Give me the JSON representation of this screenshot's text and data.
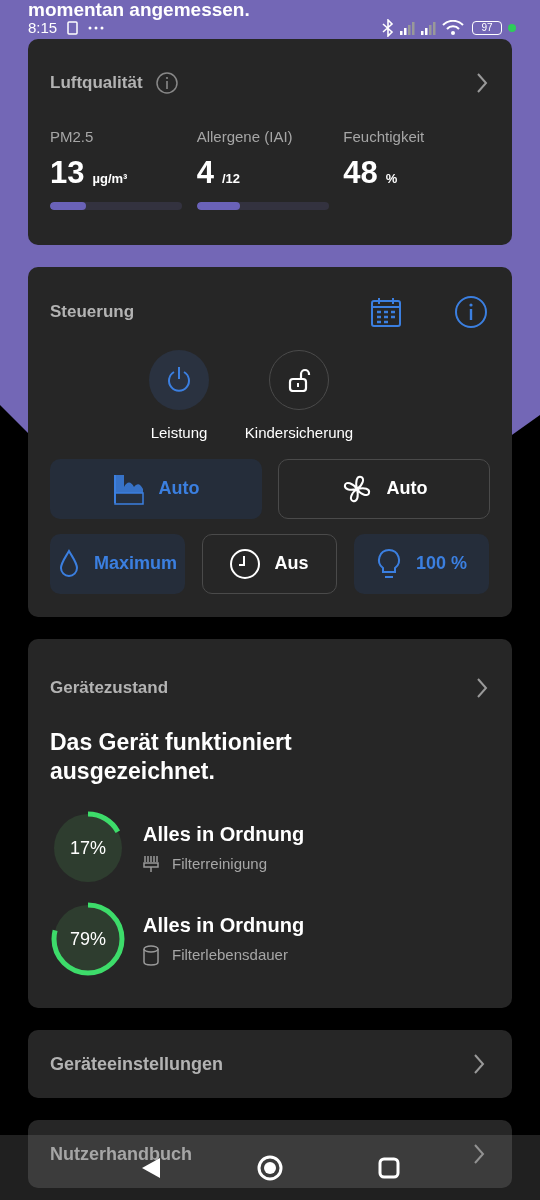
{
  "headline": "momentan angemessen.",
  "status_bar": {
    "time": "8:15",
    "battery": "97"
  },
  "air_quality": {
    "title": "Luftqualität",
    "metrics": [
      {
        "label": "PM2.5",
        "value": "13",
        "unit": "µg/m³",
        "level": 0.27
      },
      {
        "label": "Allergene (IAI)",
        "value": "4",
        "unit": "/12",
        "level": 0.33
      },
      {
        "label": "Feuchtigkeit",
        "value": "48",
        "unit": "%"
      }
    ]
  },
  "control": {
    "title": "Steuerung",
    "toggles": [
      {
        "kind": "power",
        "label": "Leistung",
        "on": true
      },
      {
        "kind": "lock",
        "label": "Kindersicherung",
        "on": false
      }
    ],
    "modes": [
      {
        "kind": "pm",
        "label": "Auto",
        "active": true
      },
      {
        "kind": "fan",
        "label": "Auto",
        "active": false
      }
    ],
    "settings": [
      {
        "kind": "drop",
        "label": "Maximum",
        "active": true
      },
      {
        "kind": "clock",
        "label": "Aus",
        "active": false
      },
      {
        "kind": "bulb",
        "label": "100 %",
        "active": true
      }
    ]
  },
  "device_status": {
    "title": "Gerätezustand",
    "message": "Das Gerät funktioniert ausgezeichnet.",
    "items": [
      {
        "kind": "brush",
        "percent": "17%",
        "level": 0.17,
        "status": "Alles in Ordnung",
        "label": "Filterreinigung"
      },
      {
        "kind": "cylinder",
        "percent": "79%",
        "level": 0.79,
        "status": "Alles in Ordnung",
        "label": "Filterlebensdauer"
      }
    ]
  },
  "links": [
    "Geräteeinstellungen",
    "Nutzerhandbuch"
  ]
}
